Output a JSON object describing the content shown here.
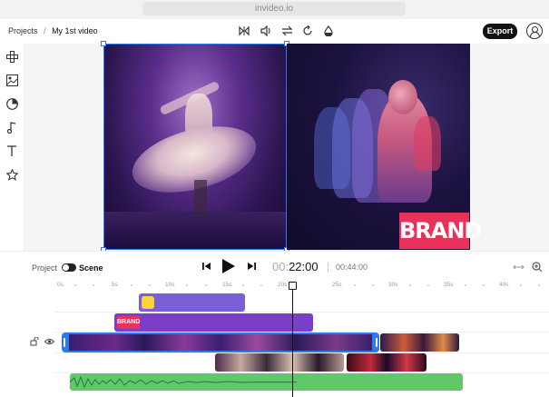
{
  "browser": {
    "url": "invideo.io"
  },
  "header": {
    "breadcrumb_root": "Projects",
    "breadcrumb_sep": "/",
    "breadcrumb_current": "My 1st video",
    "export_label": "Export"
  },
  "icons": {
    "flip": "flip-icon",
    "volume": "volume-icon",
    "swap": "swap-icon",
    "rotate": "rotate-icon",
    "opacity": "opacity-icon",
    "avatar": "user-avatar-icon"
  },
  "sidebar": {
    "items": [
      "layout-icon",
      "image-icon",
      "sticker-icon",
      "music-icon",
      "text-icon",
      "star-icon"
    ]
  },
  "canvas": {
    "brand_text": "BRAND"
  },
  "playback": {
    "project_label": "Project",
    "scene_label": "Scene",
    "current_time_dim": "00:",
    "current_time": "22:00",
    "total_time": "00:44:00"
  },
  "ruler": {
    "ticks": [
      "0s",
      "5s",
      "10s",
      "15s",
      "20s",
      "25s",
      "30s",
      "35s",
      "40s"
    ]
  },
  "timeline": {
    "brand_clip_label": "BRAND"
  },
  "colors": {
    "selection": "#2d7be8",
    "sticker_clip": "#7b5fd6",
    "brand_clip": "#7a3fc8",
    "audio_clip": "#5ec86a",
    "brand_bg": "#e8325a"
  }
}
